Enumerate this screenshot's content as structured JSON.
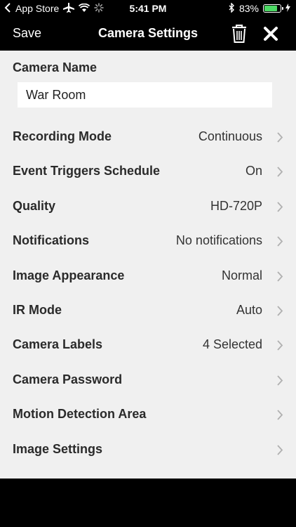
{
  "status_bar": {
    "back_app": "App Store",
    "time": "5:41 PM",
    "battery": "83%",
    "battery_level": 0.83,
    "icons": [
      "back-arrow-icon",
      "airplane-icon",
      "wifi-icon",
      "activity-spinner-icon",
      "bluetooth-icon",
      "battery-icon",
      "charging-bolt-icon"
    ]
  },
  "nav": {
    "save_label": "Save",
    "title": "Camera Settings",
    "icons": [
      "trash-icon",
      "close-icon"
    ]
  },
  "camera_name": {
    "label": "Camera Name",
    "value": "War Room"
  },
  "settings": [
    {
      "label": "Recording Mode",
      "value": "Continuous"
    },
    {
      "label": "Event Triggers Schedule",
      "value": "On"
    },
    {
      "label": "Quality",
      "value": "HD-720P"
    },
    {
      "label": "Notifications",
      "value": "No notifications"
    },
    {
      "label": "Image Appearance",
      "value": "Normal"
    },
    {
      "label": "IR Mode",
      "value": "Auto"
    },
    {
      "label": "Camera Labels",
      "value": "4 Selected"
    },
    {
      "label": "Camera Password",
      "value": ""
    },
    {
      "label": "Motion Detection Area",
      "value": ""
    },
    {
      "label": "Image Settings",
      "value": ""
    }
  ],
  "colors": {
    "bar_background": "#000000",
    "content_background": "#f0f0f0",
    "battery_fill": "#4cd964",
    "chevron": "#b0b0b0"
  }
}
